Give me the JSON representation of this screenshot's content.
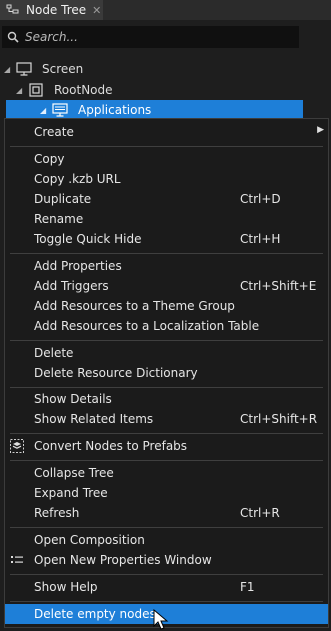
{
  "panel": {
    "tab_label": "Node Tree",
    "close_glyph": "✕",
    "search_placeholder": "Search..."
  },
  "tree": {
    "screen": {
      "label": "Screen",
      "icon": "monitor-icon",
      "expander": "◢"
    },
    "root": {
      "label": "RootNode",
      "icon": "square-node-icon",
      "expander": "◢"
    },
    "applications": {
      "label": "Applications",
      "icon": "monitor-icon",
      "expander": "◢"
    }
  },
  "menu": {
    "create": {
      "label": "Create",
      "arrow": "▶"
    },
    "copy": {
      "label": "Copy"
    },
    "copy_kzb": {
      "label": "Copy .kzb URL"
    },
    "duplicate": {
      "label": "Duplicate",
      "shortcut": "Ctrl+D"
    },
    "rename": {
      "label": "Rename"
    },
    "toggle_quick_hide": {
      "label": "Toggle Quick Hide",
      "shortcut": "Ctrl+H"
    },
    "add_properties": {
      "label": "Add Properties"
    },
    "add_triggers": {
      "label": "Add Triggers",
      "shortcut": "Ctrl+Shift+E"
    },
    "add_resources_theme": {
      "label": "Add Resources to a Theme Group"
    },
    "add_resources_localization": {
      "label": "Add Resources to a Localization Table"
    },
    "delete": {
      "label": "Delete"
    },
    "delete_resource_dictionary": {
      "label": "Delete Resource Dictionary"
    },
    "show_details": {
      "label": "Show Details"
    },
    "show_related_items": {
      "label": "Show Related Items",
      "shortcut": "Ctrl+Shift+R"
    },
    "convert_to_prefabs": {
      "label": "Convert Nodes to Prefabs",
      "icon": "prefab-icon"
    },
    "collapse_tree": {
      "label": "Collapse Tree"
    },
    "expand_tree": {
      "label": "Expand Tree"
    },
    "refresh": {
      "label": "Refresh",
      "shortcut": "Ctrl+R"
    },
    "open_composition": {
      "label": "Open Composition"
    },
    "open_properties_window": {
      "label": "Open New Properties Window",
      "icon": "list-icon"
    },
    "show_help": {
      "label": "Show Help",
      "shortcut": "F1"
    },
    "delete_empty_nodes": {
      "label": "Delete empty nodes"
    }
  },
  "colors": {
    "accent": "#1e7fd8",
    "panel_bg": "#1e1e1e",
    "menu_bg": "#1b1b1b"
  }
}
